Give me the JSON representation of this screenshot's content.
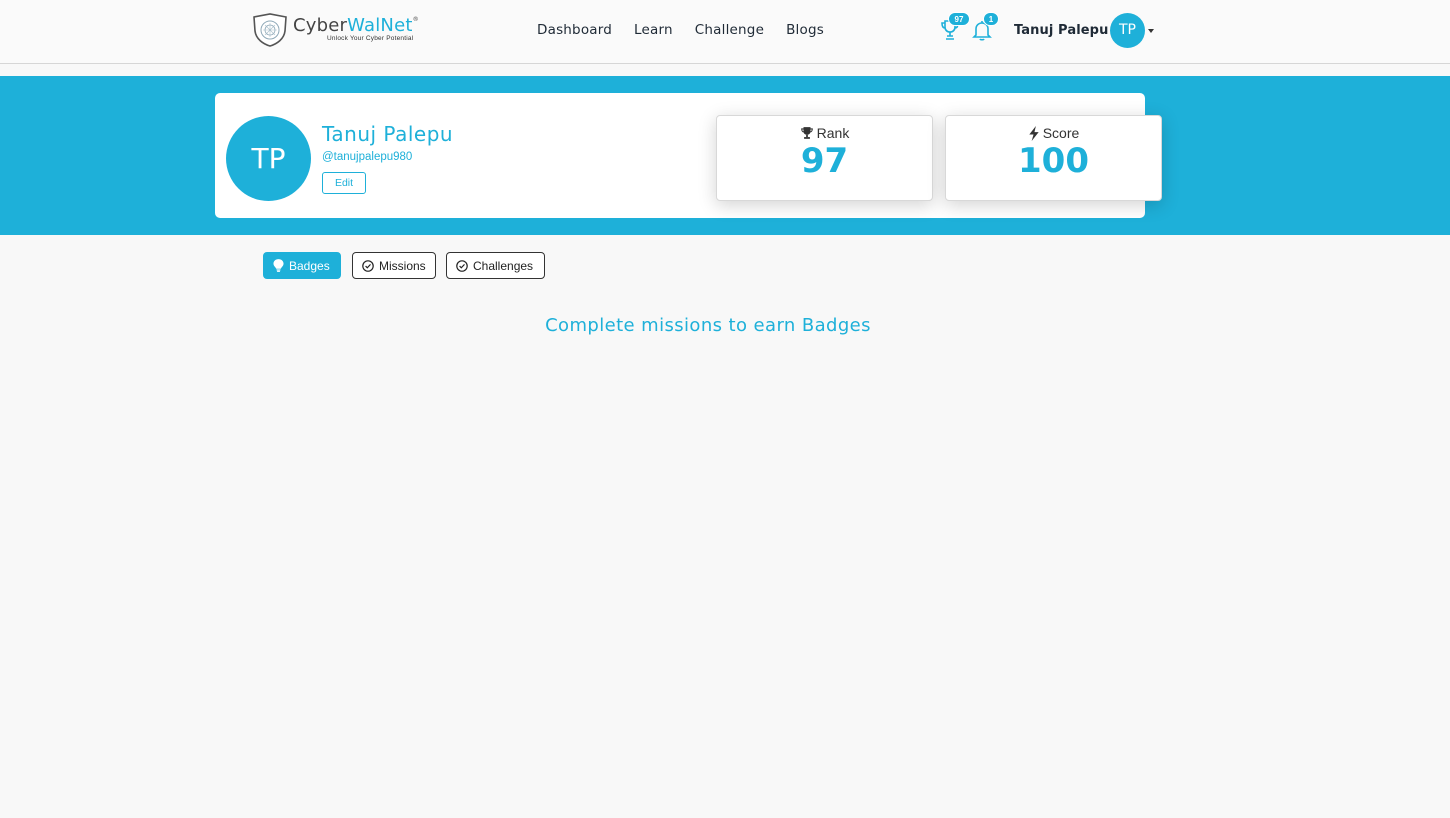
{
  "navbar": {
    "brand": {
      "name_part1": "Cyber",
      "name_part2": "WalNet",
      "registered": "®",
      "tagline": "Unlock Your Cyber Potential"
    },
    "links": [
      {
        "label": "Dashboard"
      },
      {
        "label": "Learn"
      },
      {
        "label": "Challenge"
      },
      {
        "label": "Blogs"
      }
    ],
    "trophy_count": "97",
    "notification_count": "1",
    "user_name": "Tanuj Palepu",
    "user_initials": "TP"
  },
  "profile": {
    "initials": "TP",
    "name": "Tanuj Palepu",
    "handle": "@tanujpalepu980",
    "edit_label": "Edit",
    "rank": {
      "label": "Rank",
      "value": "97",
      "icon": "trophy-icon"
    },
    "score": {
      "label": "Score",
      "value": "100",
      "icon": "bolt-icon"
    }
  },
  "tabs": [
    {
      "label": "Badges",
      "icon": "lightbulb-icon",
      "active": true
    },
    {
      "label": "Missions",
      "icon": "check-circle-icon",
      "active": false
    },
    {
      "label": "Challenges",
      "icon": "check-circle-icon",
      "active": false
    }
  ],
  "content": {
    "empty_message": "Complete missions to earn Badges"
  },
  "colors": {
    "accent": "#1eb0d9",
    "text_dark": "#1f2a36",
    "page_bg": "#f8f8f8"
  }
}
